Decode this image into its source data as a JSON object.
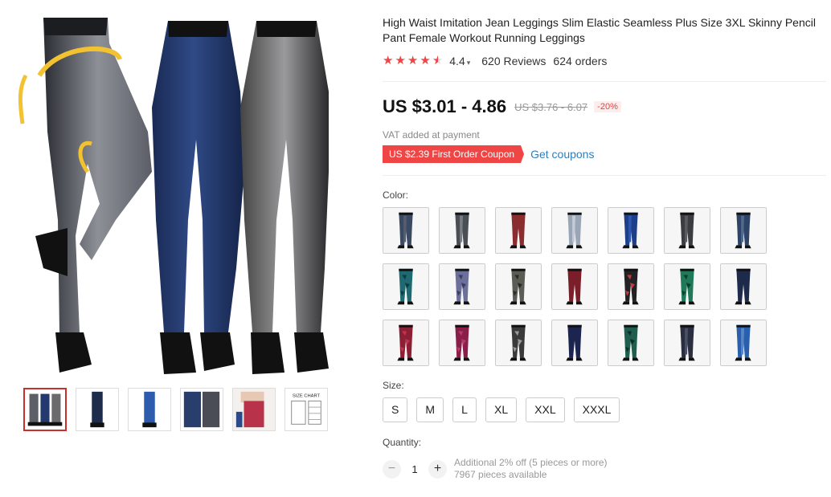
{
  "product": {
    "title": "High Waist Imitation Jean Leggings Slim Elastic Seamless Plus Size 3XL Skinny Pencil Pant Female Workout Running Leggings",
    "rating": "4.4",
    "stars_filled": 4.5,
    "reviews": "620 Reviews",
    "orders": "624 orders"
  },
  "pricing": {
    "price": "US $3.01 - 4.86",
    "old_price": "US $3.76 - 6.07",
    "discount": "-20%",
    "vat_note": "VAT added at payment",
    "coupon": "US $2.39 First Order Coupon",
    "get_coupons": "Get coupons",
    "accent_color": "#f04545",
    "link_color": "#2e7fb8"
  },
  "color_section": {
    "label": "Color:",
    "swatches": [
      {
        "fill": "#3a4a63",
        "alt": "#555e6e",
        "pattern": "denim"
      },
      {
        "fill": "#4a4e55",
        "alt": "#7a7e84",
        "pattern": "denim"
      },
      {
        "fill": "#8b2c2e",
        "alt": "#a94a48",
        "pattern": "solid"
      },
      {
        "fill": "#9aa6b6",
        "alt": "#c2cbd6",
        "pattern": "denim"
      },
      {
        "fill": "#1d3f8a",
        "alt": "#2d56ad",
        "pattern": "denim"
      },
      {
        "fill": "#3b3c40",
        "alt": "#5a5b60",
        "pattern": "denim"
      },
      {
        "fill": "#2e4466",
        "alt": "#52688c",
        "pattern": "denim"
      },
      {
        "fill": "#1e6a72",
        "alt": "#0f3a40",
        "pattern": "camo"
      },
      {
        "fill": "#6c6f9a",
        "alt": "#3a3d60",
        "pattern": "camo"
      },
      {
        "fill": "#5b5d55",
        "alt": "#2a2b28",
        "pattern": "camo"
      },
      {
        "fill": "#7a1f2a",
        "alt": "#a33444",
        "pattern": "solid"
      },
      {
        "fill": "#222226",
        "alt": "#c83a3a",
        "pattern": "camo"
      },
      {
        "fill": "#1f7a5a",
        "alt": "#0e3e2c",
        "pattern": "camo"
      },
      {
        "fill": "#1e2a4a",
        "alt": "#2e3f66",
        "pattern": "solid"
      },
      {
        "fill": "#8c1f34",
        "alt": "#c0344e",
        "pattern": "camo"
      },
      {
        "fill": "#8a1e4a",
        "alt": "#b83a6a",
        "pattern": "camo"
      },
      {
        "fill": "#3a3a3a",
        "alt": "#9a9a9a",
        "pattern": "camo"
      },
      {
        "fill": "#1c2450",
        "alt": "#2a3468",
        "pattern": "solid"
      },
      {
        "fill": "#1f5e4e",
        "alt": "#0d2e26",
        "pattern": "camo"
      },
      {
        "fill": "#2a2e3e",
        "alt": "#4a5068",
        "pattern": "denim"
      },
      {
        "fill": "#2a5fae",
        "alt": "#5a86c6",
        "pattern": "denim"
      }
    ]
  },
  "size_section": {
    "label": "Size:",
    "options": [
      "S",
      "M",
      "L",
      "XL",
      "XXL",
      "XXXL"
    ]
  },
  "quantity_section": {
    "label": "Quantity:",
    "minus": "−",
    "plus": "+",
    "value": "1",
    "bulk_note": "Additional 2% off (5 pieces or more)",
    "available": "7967 pieces available"
  },
  "gallery": {
    "thumbnails": [
      "three-pairs",
      "dark-pair",
      "blue-pair",
      "denim-closeup",
      "red-model",
      "size-chart"
    ],
    "size_chart_text": "SIZE CHART"
  }
}
